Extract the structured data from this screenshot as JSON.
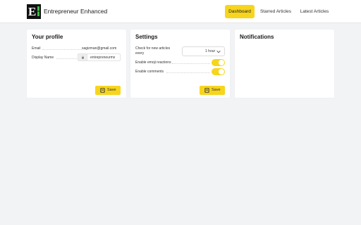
{
  "header": {
    "logo_letter": "E",
    "app_title": "Entrepreneur Enhanced",
    "nav": [
      {
        "label": "Dashboard",
        "active": true
      },
      {
        "label": "Starred Articles",
        "active": false
      },
      {
        "label": "Latest Articles",
        "active": false
      }
    ]
  },
  "profile": {
    "title": "Your profile",
    "email_label": "Email",
    "email_value": "sagizman@gmail.com",
    "display_name_label": "Display Name",
    "display_name_value": "entrepreneurmx",
    "save_label": "Save"
  },
  "settings": {
    "title": "Settings",
    "check_label": "Check for new articles every",
    "check_value": "1 hour",
    "emoji_label": "Enable emoji reactions",
    "emoji_enabled": true,
    "comments_label": "Enable comments",
    "comments_enabled": true,
    "save_label": "Save"
  },
  "notifications": {
    "title": "Notifications"
  },
  "colors": {
    "accent": "#f7d51d",
    "background": "#f2f3f5",
    "card": "#ffffff",
    "logo_green": "#3fbf45"
  },
  "icons": {
    "save": "floppy-disk-icon",
    "lock": "lock-icon",
    "select": "chevron-down-icon"
  }
}
